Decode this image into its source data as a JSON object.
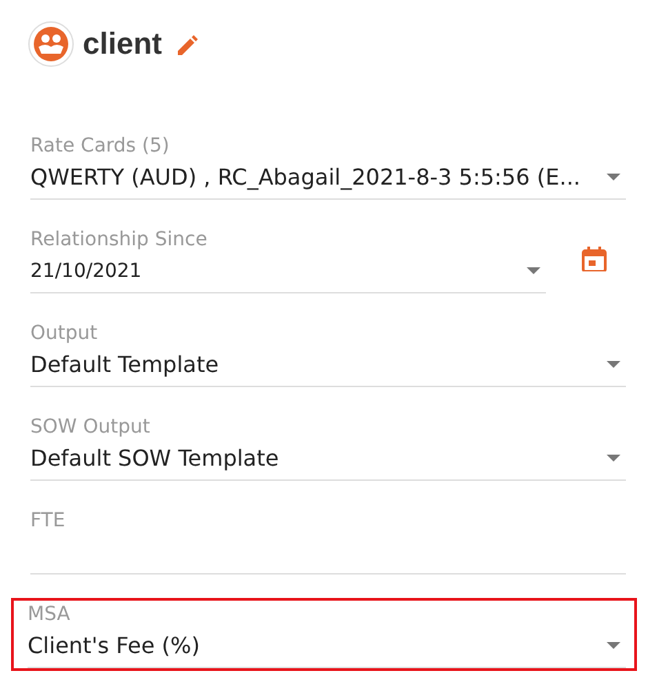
{
  "header": {
    "title": "client"
  },
  "fields": [
    {
      "kind": "select",
      "label": "Rate Cards (5)",
      "value": "QWERTY (AUD) , RC_Abagail_2021-8-3 5:5:56 (E...",
      "highlighted": false
    },
    {
      "kind": "date",
      "label": "Relationship Since",
      "value": "21/10/2021",
      "highlighted": false
    },
    {
      "kind": "select",
      "label": "Output",
      "value": "Default Template",
      "highlighted": false
    },
    {
      "kind": "select",
      "label": "SOW Output",
      "value": "Default SOW Template",
      "highlighted": false
    },
    {
      "kind": "text",
      "label": "FTE",
      "highlighted": false
    },
    {
      "kind": "select",
      "label": "MSA",
      "value": "Client's Fee (%)",
      "highlighted": true
    }
  ]
}
